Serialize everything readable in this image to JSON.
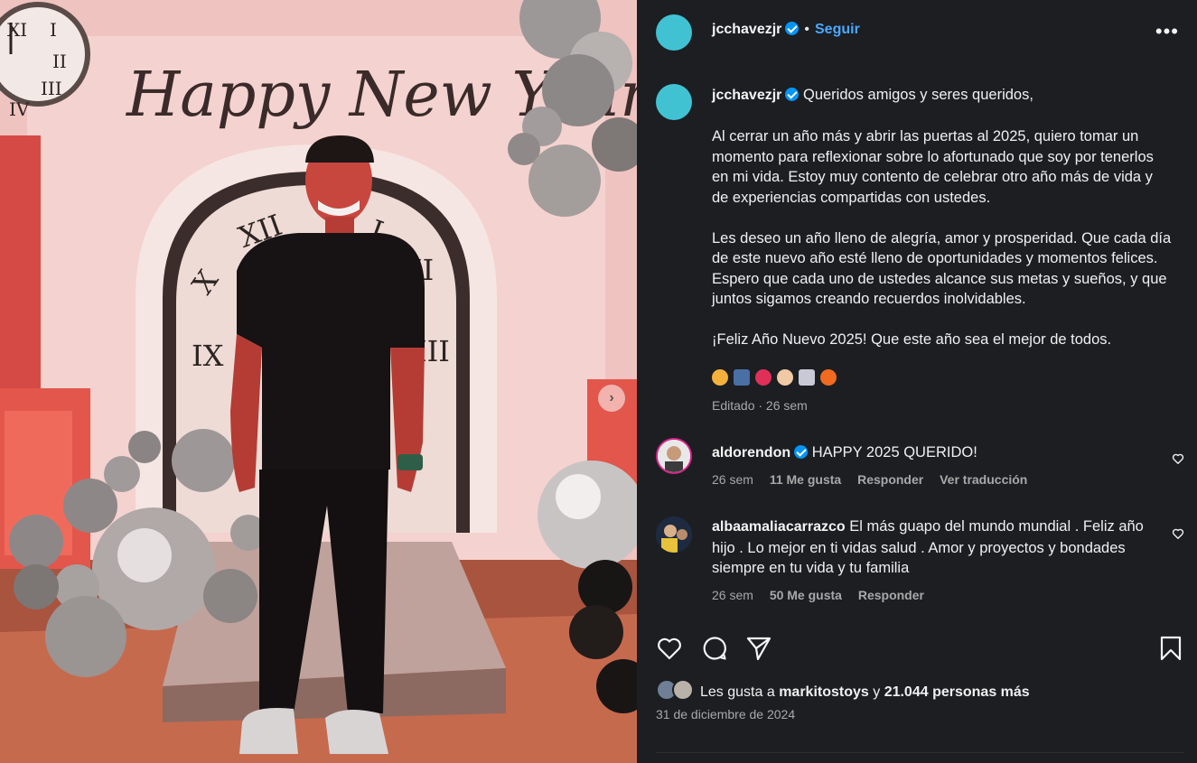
{
  "post": {
    "author": "jcchavezjr",
    "follow_label": "Seguir",
    "separator": "•",
    "more_label": "•••",
    "photo_text": "Happy New Year",
    "caption_paragraphs": [
      "Queridos amigos y seres queridos,",
      "Al cerrar un año más y abrir las puertas al 2025, quiero tomar un momento para reflexionar sobre lo afortunado que soy por tenerlos en mi vida. Estoy muy contento de celebrar otro año más de vida y de experiencias compartidas con ustedes.",
      "Les deseo un año lleno de alegría, amor y prosperidad. Que cada día de este nuevo año esté lleno de oportunidades y momentos felices. Espero que cada uno de ustedes alcance sus metas y sueños, y que juntos sigamos creando recuerdos inolvidables.",
      "¡Feliz Año Nuevo 2025! Que este año sea el mejor de todos."
    ],
    "edited_label": "Editado · 26 sem",
    "likes_prefix": "Les gusta a",
    "likes_user": "markitostoys",
    "likes_conj": "y",
    "likes_rest": "21.044 personas más",
    "date": "31 de diciembre de 2024"
  },
  "comments": [
    {
      "user": "aldorendon",
      "verified": true,
      "text": "HAPPY 2025 QUERIDO!",
      "time": "26 sem",
      "likes": "11 Me gusta",
      "reply": "Responder",
      "translate": "Ver traducción"
    },
    {
      "user": "albaamaliacarrazco",
      "verified": false,
      "text": "El más guapo del mundo mundial . Feliz año hijo . Lo mejor en ti vidas salud . Amor y proyectos y bondades siempre en tu vida y tu familia",
      "time": "26 sem",
      "likes": "50 Me gusta",
      "reply": "Responder"
    }
  ],
  "colors": {
    "panel_bg": "#1c1e22",
    "accent": "#4aa8ff",
    "verified": "#0095f6",
    "avatar": "#41c2d3"
  },
  "icons": [
    "heart-icon",
    "comment-icon",
    "share-icon",
    "bookmark-icon",
    "more-icon",
    "verified-icon",
    "chevron-right-icon"
  ]
}
